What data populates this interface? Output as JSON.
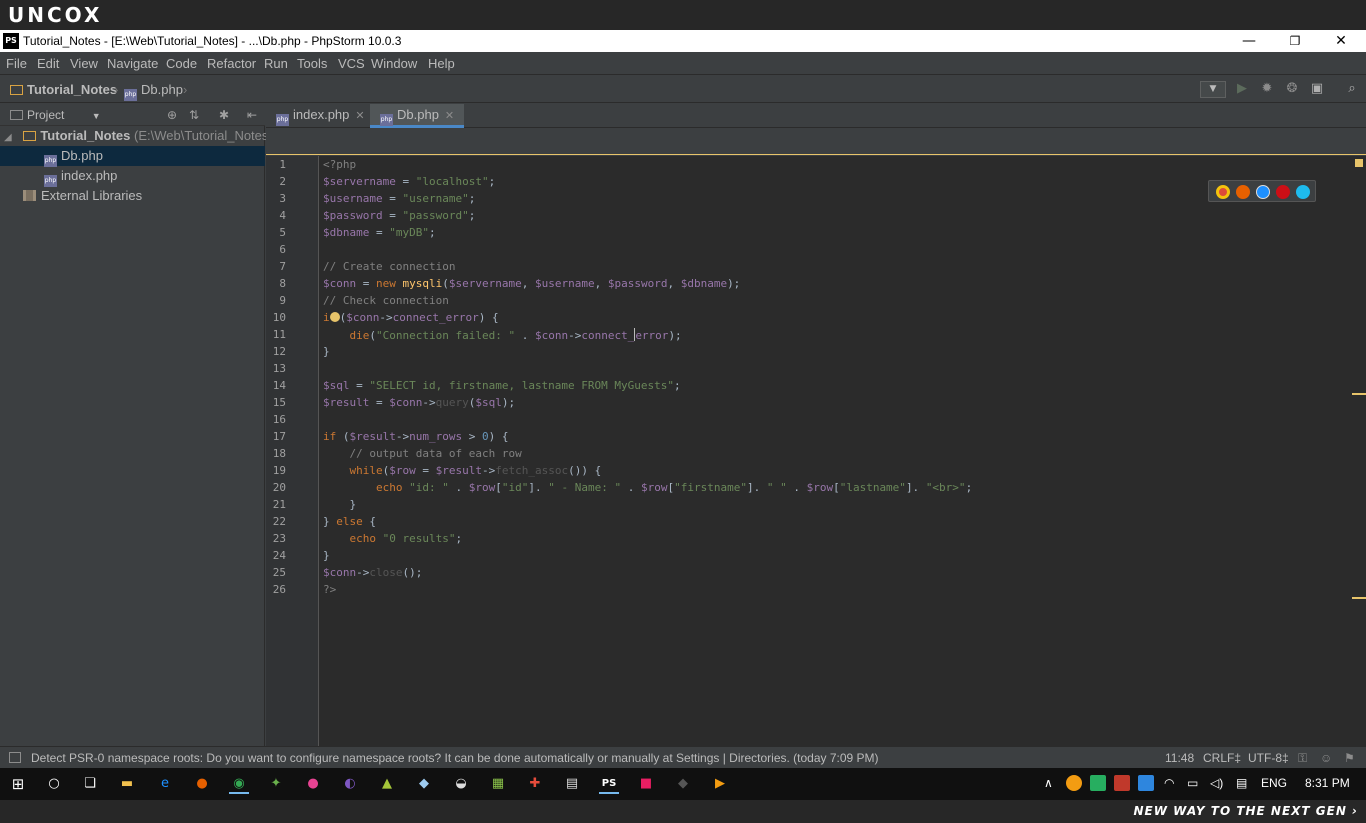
{
  "watermark": {
    "logo": "UNCOX",
    "tagline": "NEW WAY TO THE NEXT GEN ›"
  },
  "window": {
    "title": "Tutorial_Notes - [E:\\Web\\Tutorial_Notes] - ...\\Db.php - PhpStorm 10.0.3",
    "app_icon": "PS",
    "minimize": "—",
    "restore": "❐",
    "close": "✕"
  },
  "menu": [
    "File",
    "Edit",
    "View",
    "Navigate",
    "Code",
    "Refactor",
    "Run",
    "Tools",
    "VCS",
    "Window",
    "Help"
  ],
  "navbar": {
    "project": "Tutorial_Notes",
    "file": "Db.php"
  },
  "project_panel": {
    "label": "Project",
    "root": {
      "name": "Tutorial_Notes",
      "path": "(E:\\Web\\Tutorial_Notes)"
    },
    "files": [
      "Db.php",
      "index.php"
    ],
    "external": "External Libraries"
  },
  "tabs": [
    {
      "label": "index.php",
      "active": false
    },
    {
      "label": "Db.php",
      "active": true
    }
  ],
  "code": {
    "line_numbers": [
      "1",
      "2",
      "3",
      "4",
      "5",
      "6",
      "7",
      "8",
      "9",
      "10",
      "11",
      "12",
      "13",
      "14",
      "15",
      "16",
      "17",
      "18",
      "19",
      "20",
      "21",
      "22",
      "23",
      "24",
      "25",
      "26"
    ]
  },
  "status": {
    "message": "Detect PSR-0 namespace roots: Do you want to configure namespace roots? It can be done automatically or manually at Settings | Directories. (today 7:09 PM)",
    "position": "11:48",
    "line_sep": "CRLF‡",
    "encoding": "UTF-8‡"
  },
  "taskbar": {
    "language": "ENG",
    "time": "8:31 PM",
    "active_app": "PS"
  },
  "colors": {
    "editor_bg": "#2b2b2b",
    "variable": "#9876aa",
    "string": "#6a8759",
    "keyword": "#cc7832",
    "comment": "#808080",
    "function": "#ffc66d",
    "number": "#6897bb",
    "selection": "#0d293e"
  }
}
